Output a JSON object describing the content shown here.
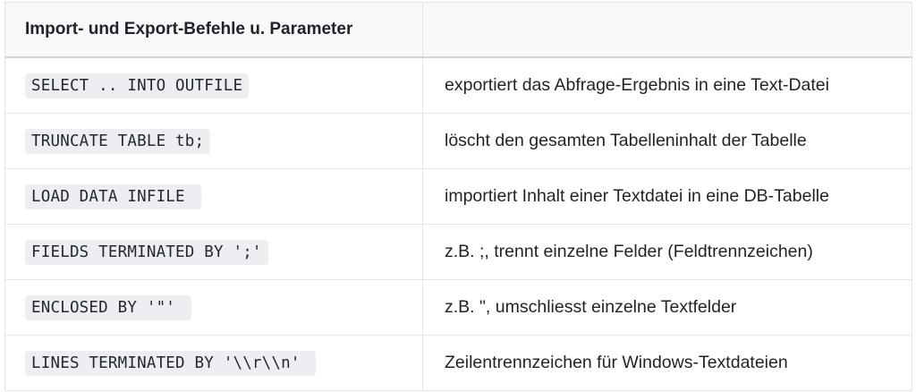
{
  "table": {
    "headers": [
      "Import- und Export-Befehle u. Parameter",
      ""
    ],
    "rows": [
      {
        "command": "SELECT .. INTO OUTFILE",
        "description": "exportiert das Abfrage-Ergebnis in eine Text-Datei"
      },
      {
        "command": "TRUNCATE TABLE tb;",
        "description": "löscht den gesamten Tabelleninhalt der Tabelle"
      },
      {
        "command": "LOAD DATA INFILE ",
        "description": "importiert Inhalt einer Textdatei in eine DB-Tabelle"
      },
      {
        "command": "FIELDS TERMINATED BY ';'",
        "description": "z.B. ;, trennt einzelne Felder (Feldtrennzeichen)"
      },
      {
        "command": "ENCLOSED BY '\"' ",
        "description": "z.B. \", umschliesst einzelne Textfelder"
      },
      {
        "command": "LINES TERMINATED BY '\\\\r\\\\n' ",
        "description": "Zeilentrennzeichen für Windows-Textdateien"
      }
    ]
  }
}
